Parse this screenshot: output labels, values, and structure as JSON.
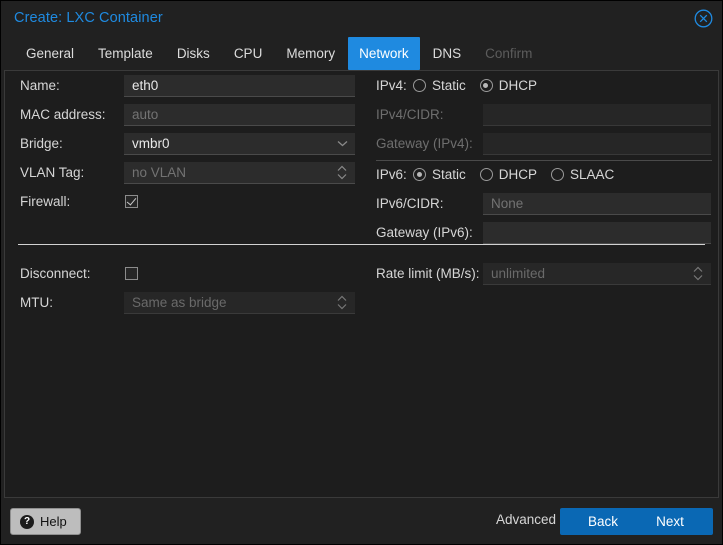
{
  "window": {
    "title": "Create: LXC Container",
    "close_icon": "close-circle-icon"
  },
  "tabs": [
    {
      "label": "General",
      "active": false,
      "disabled": false
    },
    {
      "label": "Template",
      "active": false,
      "disabled": false
    },
    {
      "label": "Disks",
      "active": false,
      "disabled": false
    },
    {
      "label": "CPU",
      "active": false,
      "disabled": false
    },
    {
      "label": "Memory",
      "active": false,
      "disabled": false
    },
    {
      "label": "Network",
      "active": true,
      "disabled": false
    },
    {
      "label": "DNS",
      "active": false,
      "disabled": false
    },
    {
      "label": "Confirm",
      "active": false,
      "disabled": true
    }
  ],
  "left": {
    "name": {
      "label": "Name:",
      "value": "eth0"
    },
    "mac": {
      "label": "MAC address:",
      "placeholder": "auto",
      "value": ""
    },
    "bridge": {
      "label": "Bridge:",
      "value": "vmbr0",
      "icon": "chevron-down-icon"
    },
    "vlan": {
      "label": "VLAN Tag:",
      "placeholder": "no VLAN",
      "value": "",
      "icon": "spinner-updown-icon"
    },
    "firewall": {
      "label": "Firewall:",
      "checked": true
    },
    "disconnect": {
      "label": "Disconnect:",
      "checked": false
    },
    "mtu": {
      "label": "MTU:",
      "placeholder": "Same as bridge",
      "value": "",
      "icon": "spinner-updown-icon"
    }
  },
  "right": {
    "ipv4": {
      "label": "IPv4:",
      "options": [
        "Static",
        "DHCP"
      ],
      "selected": "DHCP"
    },
    "ipv4_cidr": {
      "label": "IPv4/CIDR:",
      "value": "",
      "disabled": true
    },
    "ipv4_gateway": {
      "label": "Gateway (IPv4):",
      "value": "",
      "disabled": true
    },
    "ipv6": {
      "label": "IPv6:",
      "options": [
        "Static",
        "DHCP",
        "SLAAC"
      ],
      "selected": "Static"
    },
    "ipv6_cidr": {
      "label": "IPv6/CIDR:",
      "placeholder": "None",
      "value": ""
    },
    "ipv6_gateway": {
      "label": "Gateway (IPv6):",
      "value": ""
    },
    "rate_limit": {
      "label": "Rate limit (MB/s):",
      "placeholder": "unlimited",
      "value": "",
      "icon": "spinner-updown-icon"
    }
  },
  "footer": {
    "help_label": "Help",
    "help_icon": "question-mark-icon",
    "advanced_label": "Advanced",
    "advanced_checked": true,
    "back_label": "Back",
    "next_label": "Next"
  },
  "colors": {
    "accent_blue": "#1f8ae0",
    "button_blue": "#0a68b4",
    "panel_bg": "#1d1d1d",
    "window_bg": "#212121",
    "field_bg": "#2c2c2c"
  }
}
